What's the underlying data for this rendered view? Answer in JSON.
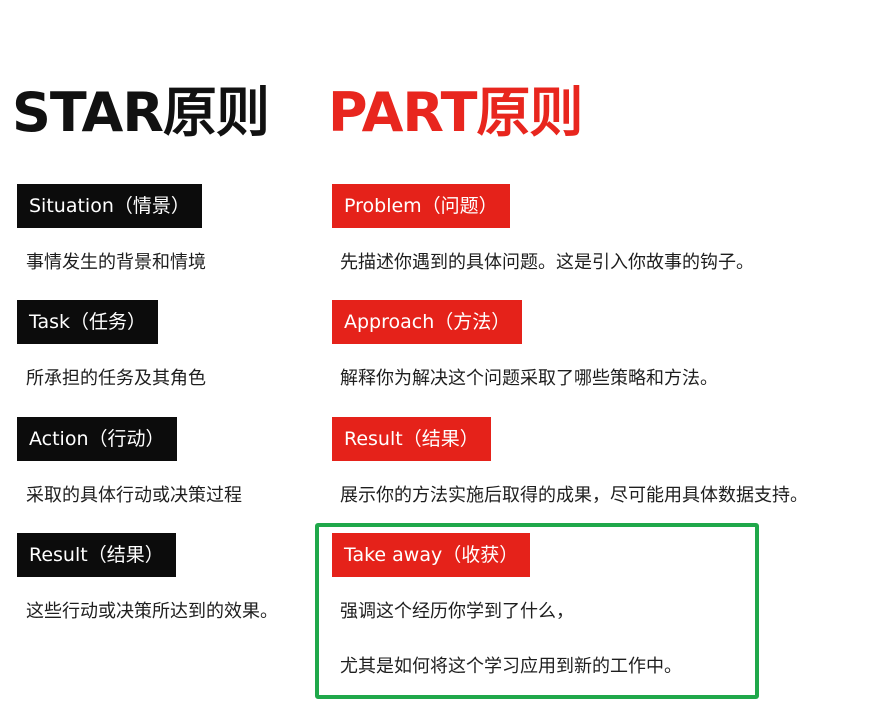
{
  "star": {
    "title": "STAR原则",
    "items": [
      {
        "tag": "Situation（情景）",
        "desc": "事情发生的背景和情境"
      },
      {
        "tag": "Task（任务）",
        "desc": "所承担的任务及其角色"
      },
      {
        "tag": "Action（行动）",
        "desc": "采取的具体行动或决策过程"
      },
      {
        "tag": "Result（结果）",
        "desc": "这些行动或决策所达到的效果。"
      }
    ]
  },
  "part": {
    "title": "PART原则",
    "items": [
      {
        "tag": "Problem（问题）",
        "desc": "先描述你遇到的具体问题。这是引入你故事的钩子。"
      },
      {
        "tag": "Approach（方法）",
        "desc": "解释你为解决这个问题采取了哪些策略和方法。"
      },
      {
        "tag": "Result（结果）",
        "desc": "展示你的方法实施后取得的成果，尽可能用具体数据支持。"
      },
      {
        "tag": "Take away（收获）",
        "desc": "强调这个经历你学到了什么，",
        "desc2": "尤其是如何将这个学习应用到新的工作中。"
      }
    ]
  },
  "colors": {
    "star_tag_bg": "#0c0c0c",
    "part_tag_bg": "#e5221a",
    "part_title": "#e8261e",
    "highlight_border": "#20a84a"
  }
}
